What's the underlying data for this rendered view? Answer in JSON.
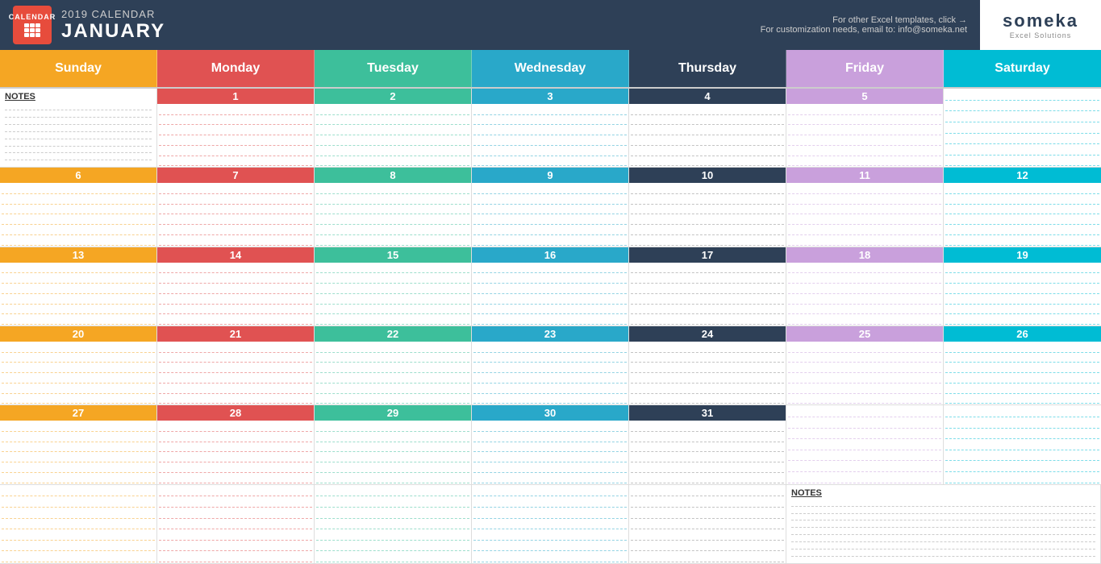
{
  "header": {
    "year": "2019 CALENDAR",
    "month": "JANUARY",
    "icon_top": "CALENDAR",
    "info_line1": "For other Excel templates, click →",
    "info_line2": "For customization needs, email to: info@someka.net",
    "logo_text": "someka",
    "logo_sub": "Excel Solutions"
  },
  "days": [
    "Sunday",
    "Monday",
    "Tuesday",
    "Wednesday",
    "Thursday",
    "Friday",
    "Saturday"
  ],
  "calendar": {
    "notes_label": "NOTES",
    "notes_label2": "NOTES",
    "dates": [
      {
        "num": "1",
        "col": 2,
        "row": 1,
        "day": "tue"
      },
      {
        "num": "2",
        "col": 3,
        "row": 1,
        "day": "wed"
      },
      {
        "num": "3",
        "col": 4,
        "row": 1,
        "day": "thu"
      },
      {
        "num": "4",
        "col": 5,
        "row": 1,
        "day": "fri"
      },
      {
        "num": "5",
        "col": 6,
        "row": 1,
        "day": "sat"
      },
      {
        "num": "6",
        "col": 1,
        "row": 2,
        "day": "sun"
      },
      {
        "num": "7",
        "col": 2,
        "row": 2,
        "day": "mon"
      },
      {
        "num": "8",
        "col": 3,
        "row": 2,
        "day": "tue"
      },
      {
        "num": "9",
        "col": 4,
        "row": 2,
        "day": "wed"
      },
      {
        "num": "10",
        "col": 5,
        "row": 2,
        "day": "thu"
      },
      {
        "num": "11",
        "col": 6,
        "row": 2,
        "day": "fri"
      },
      {
        "num": "12",
        "col": 7,
        "row": 2,
        "day": "sat"
      },
      {
        "num": "13",
        "col": 1,
        "row": 3,
        "day": "sun"
      },
      {
        "num": "14",
        "col": 2,
        "row": 3,
        "day": "mon"
      },
      {
        "num": "15",
        "col": 3,
        "row": 3,
        "day": "tue"
      },
      {
        "num": "16",
        "col": 4,
        "row": 3,
        "day": "wed"
      },
      {
        "num": "17",
        "col": 5,
        "row": 3,
        "day": "thu"
      },
      {
        "num": "18",
        "col": 6,
        "row": 3,
        "day": "fri"
      },
      {
        "num": "19",
        "col": 7,
        "row": 3,
        "day": "sat"
      },
      {
        "num": "20",
        "col": 1,
        "row": 4,
        "day": "sun"
      },
      {
        "num": "21",
        "col": 2,
        "row": 4,
        "day": "mon"
      },
      {
        "num": "22",
        "col": 3,
        "row": 4,
        "day": "tue"
      },
      {
        "num": "23",
        "col": 4,
        "row": 4,
        "day": "wed"
      },
      {
        "num": "24",
        "col": 5,
        "row": 4,
        "day": "thu"
      },
      {
        "num": "25",
        "col": 6,
        "row": 4,
        "day": "fri"
      },
      {
        "num": "26",
        "col": 7,
        "row": 4,
        "day": "sat"
      },
      {
        "num": "27",
        "col": 1,
        "row": 5,
        "day": "sun"
      },
      {
        "num": "28",
        "col": 2,
        "row": 5,
        "day": "mon"
      },
      {
        "num": "29",
        "col": 3,
        "row": 5,
        "day": "tue"
      },
      {
        "num": "30",
        "col": 4,
        "row": 5,
        "day": "wed"
      },
      {
        "num": "31",
        "col": 5,
        "row": 5,
        "day": "thu"
      }
    ]
  },
  "colors": {
    "sun": "#f5a623",
    "mon": "#e05252",
    "tue": "#3dbf9b",
    "wed": "#29a8c9",
    "thu": "#2e4057",
    "fri": "#c9a0dc",
    "sat": "#00bcd4",
    "header_bg": "#2e4057"
  }
}
